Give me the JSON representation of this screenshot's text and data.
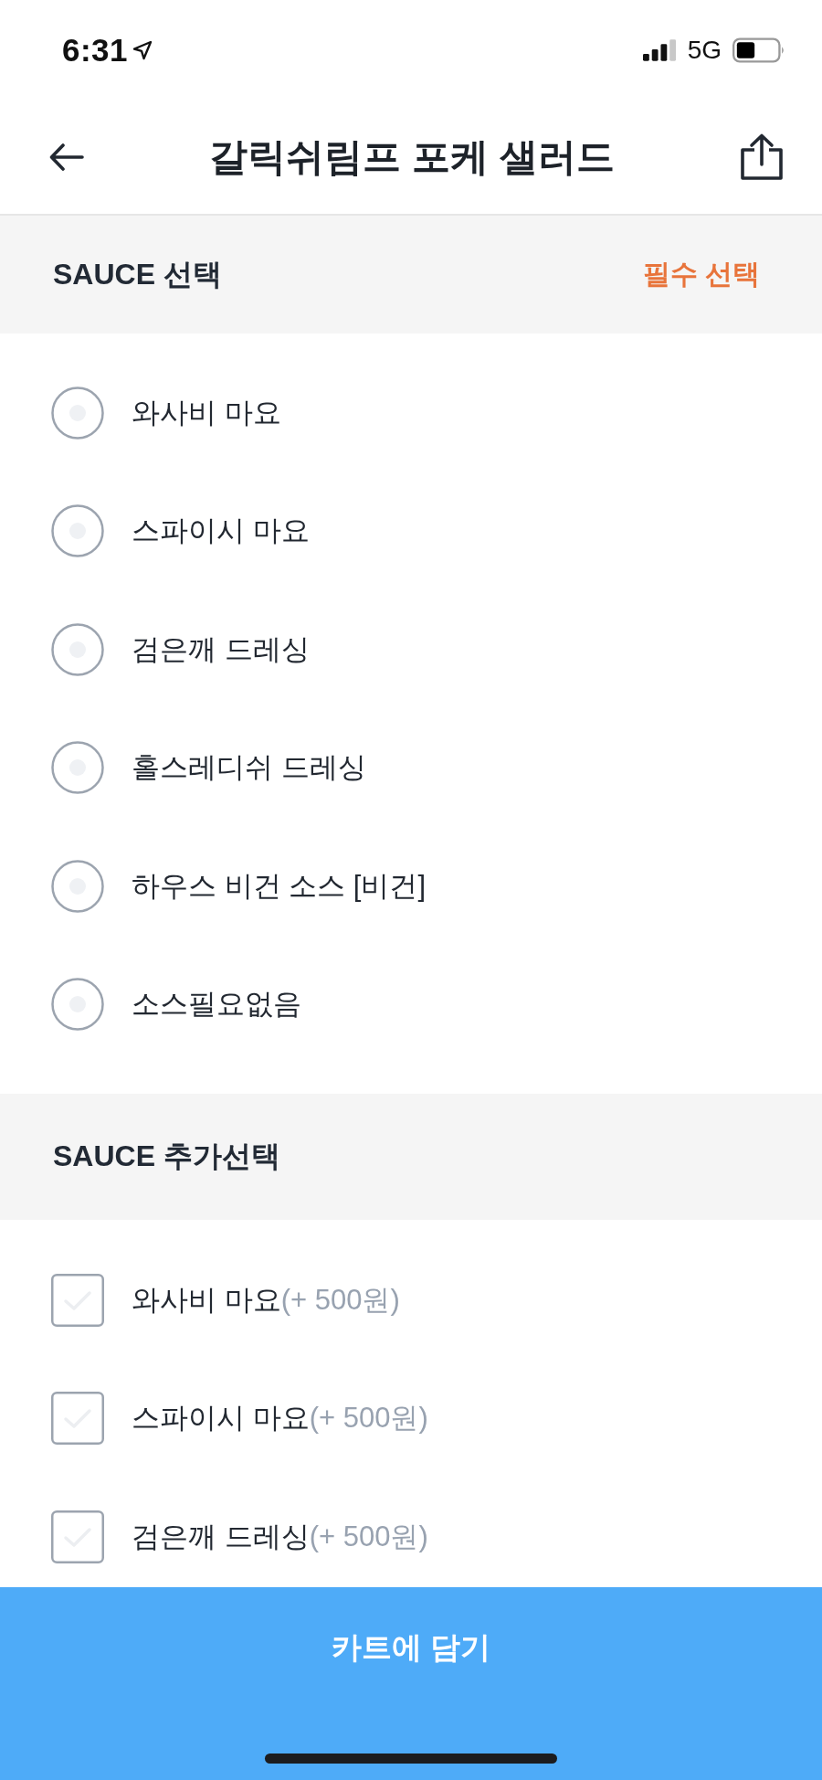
{
  "status_bar": {
    "time": "6:31",
    "network": "5G"
  },
  "header": {
    "title": "갈릭쉬림프 포케 샐러드"
  },
  "sections": [
    {
      "kind": "radio",
      "title": "SAUCE 선택",
      "badge": "필수 선택",
      "options": [
        {
          "label": "와사비 마요",
          "selected": false
        },
        {
          "label": "스파이시 마요",
          "selected": false
        },
        {
          "label": "검은깨 드레싱",
          "selected": false
        },
        {
          "label": "홀스레디쉬 드레싱",
          "selected": false
        },
        {
          "label": "하우스 비건 소스 [비건]",
          "selected": false
        },
        {
          "label": "소스필요없음",
          "selected": false
        }
      ]
    },
    {
      "kind": "checkbox",
      "title": "SAUCE 추가선택",
      "options": [
        {
          "label": "와사비 마요",
          "price": "(+ 500원)",
          "checked": false
        },
        {
          "label": "스파이시 마요",
          "price": "(+ 500원)",
          "checked": false
        },
        {
          "label": "검은깨 드레싱",
          "price": "(+ 500원)",
          "checked": false
        }
      ]
    }
  ],
  "cart_button": {
    "label": "카트에 담기"
  }
}
